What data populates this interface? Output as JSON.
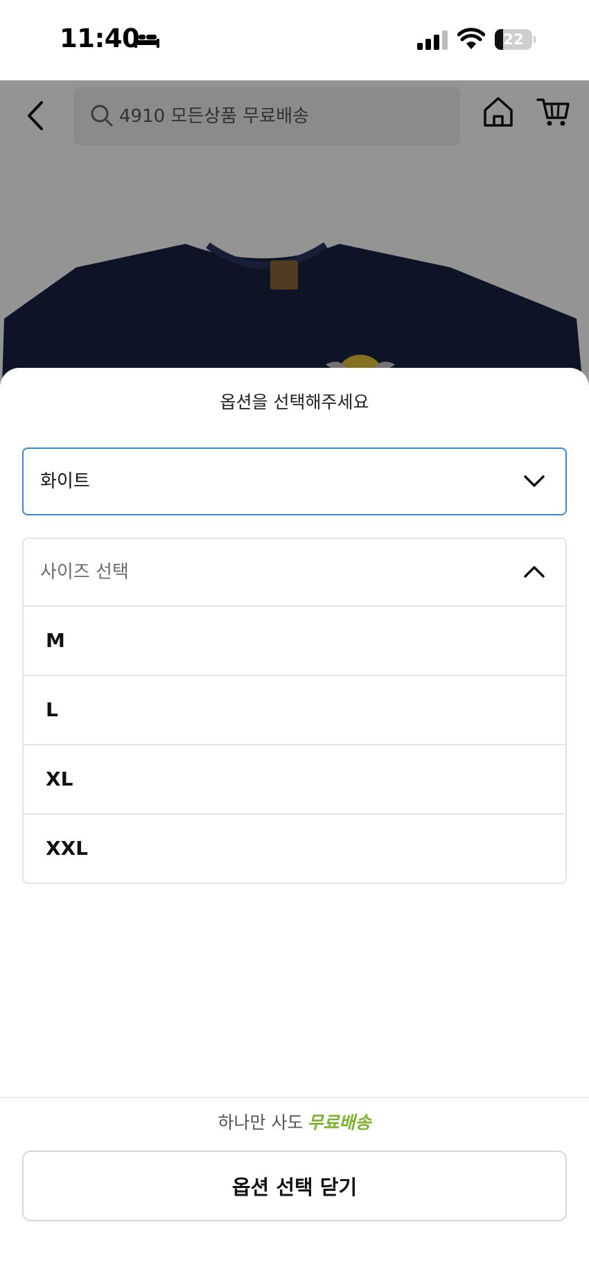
{
  "status_bar": {
    "time": "11:40",
    "battery_percent": 22,
    "battery_label": "22"
  },
  "top_nav": {
    "search_text": "4910 모든상품 무료배송"
  },
  "sheet": {
    "title": "옵션을 선택해주세요",
    "color_select": {
      "selected_value": "화이트"
    },
    "size_dropdown": {
      "header_label": "사이즈 선택",
      "options": [
        {
          "label": "M"
        },
        {
          "label": "L"
        },
        {
          "label": "XL"
        },
        {
          "label": "XXL"
        }
      ]
    },
    "promo": {
      "prefix": "하나만 사도",
      "highlight": "무료배송"
    },
    "close_button_label": "옵션 선택 닫기"
  },
  "colors": {
    "accent_border": "#3a86d8",
    "promo_green": "#7cb32a",
    "shirt_navy": "#1a2142"
  }
}
